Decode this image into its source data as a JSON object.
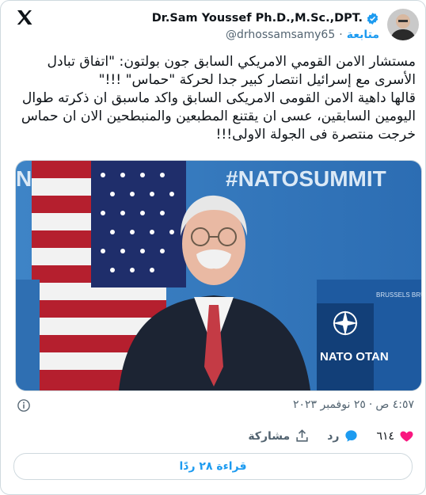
{
  "header": {
    "display_name": "Dr.Sam Youssef Ph.D.,M.Sc.,DPT.",
    "handle": "@drhossamsamy65",
    "separator": "·",
    "follow_label": "متابعة"
  },
  "tweet": {
    "text": "مستشار الامن القومي الامريكي السابق جون بولتون: \"اتفاق تبادل الأسرى مع إسرائيل انتصار كبير جدا لحركة \"حماس\"  !!!\"\n قالها داهية الامن القومى الامريكى السابق واكد ماسبق ان ذكرته طوال اليومين السابقين، عسى ان يقتنع المطبعين والمنبطحين الان ان حماس خرجت منتصرة فى الجولة الاولى!!!",
    "image_sign_text": "#NATOSUMMIT",
    "image_banner_text": "NATO",
    "image_podium_text": "NATO OTAN",
    "image_banner_side": "BRUSSELS BRUXELLES"
  },
  "meta": {
    "time": "٤:٥٧ ص",
    "dot": "·",
    "date": "٢٥ نوفمبر ٢٠٢٣"
  },
  "actions": {
    "likes": "٦١٤",
    "reply_label": "رد",
    "share_label": "مشاركة"
  },
  "read_replies": "قراءة ٢٨ ردًا",
  "colors": {
    "accent": "#1d9bf0",
    "like": "#f91880",
    "text": "#0f1419",
    "muted": "#536471"
  }
}
